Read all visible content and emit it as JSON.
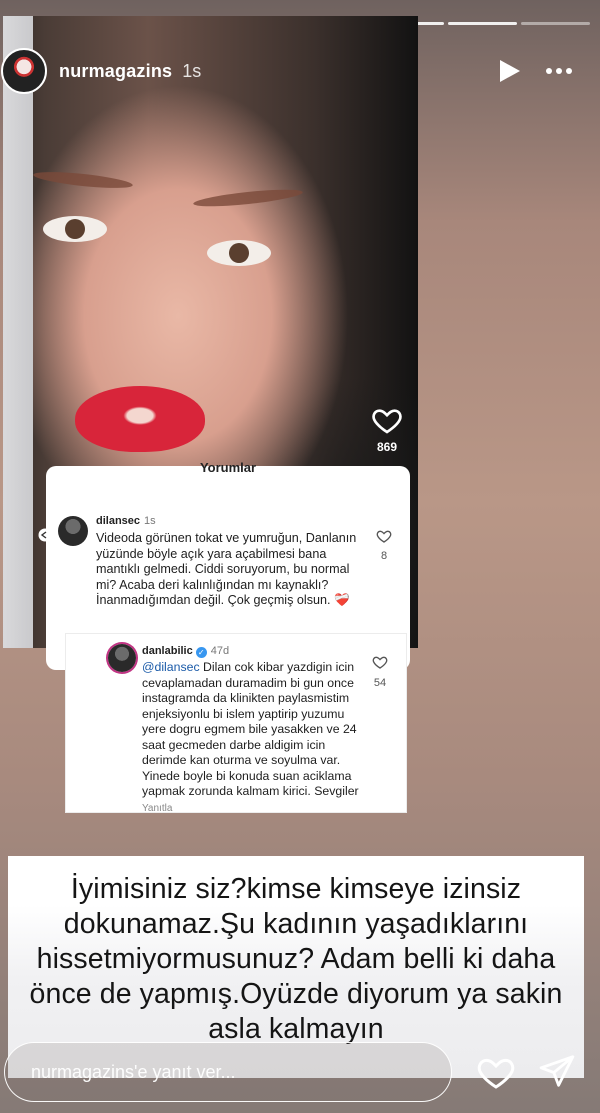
{
  "story": {
    "progress_segments": 8,
    "header": {
      "username": "nurmagazins",
      "time": "1s",
      "play_icon": "play-icon",
      "more_icon": "more-icon"
    },
    "video": {
      "like_count": "869"
    },
    "comments_title": "Yorumlar",
    "comment": {
      "username": "dilansec",
      "age": "1s",
      "text": "Videoda görünen tokat ve yumruğun, Danlanın yüzünde böyle açık yara açabilmesi bana mantıklı gelmedi. Ciddi soruyorum, bu normal mi? Acaba deri kalınlığından mı kaynaklı? İnanmadığımdan değil. Çok geçmiş olsun. ❤️‍🩹",
      "like_count": "8"
    },
    "reply": {
      "username": "danlabilic",
      "age": "47d",
      "mention": "@dilansec",
      "text": " Dilan cok kibar yazdigin icin cevaplamadan duramadim bi gun once instagramda da klinikten paylasmistim enjeksiyonlu bi islem yaptirip yuzumu yere dogru egmem bile yasakken ve  24 saat gecmeden darbe aldigim icin derimde kan oturma ve soyulma var. Yinede boyle bi konuda suan aciklama yapmak zorunda kalmam kirici. Sevgiler",
      "like_count": "54",
      "reply_link": "Yanıtla"
    },
    "caption": "İyimisiniz siz?kimse kimseye izinsiz dokunamaz.Şu kadının yaşadıklarını hissetmiyormusunuz? Adam belli ki daha önce de yapmış.Oyüzde diyorum ya sakin asla kalmayın",
    "reply_bar": {
      "placeholder": "nurmagazins'e yanıt ver...",
      "heart_icon": "heart-icon",
      "send_icon": "send-icon"
    }
  }
}
